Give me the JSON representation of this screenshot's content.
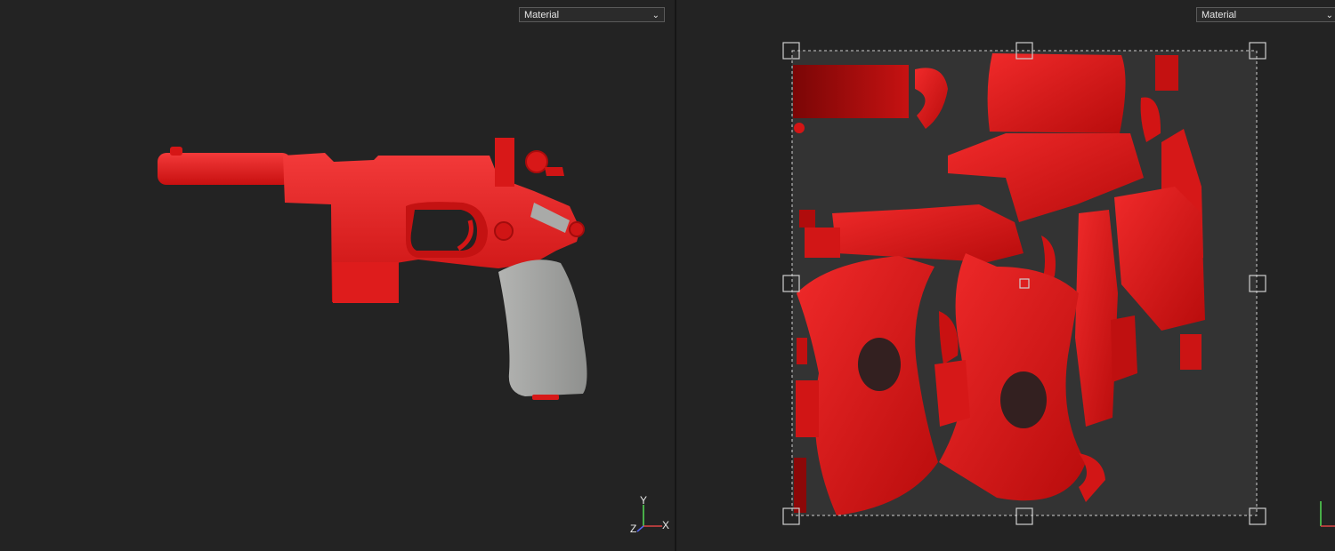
{
  "left_viewport": {
    "shading_mode": "Material",
    "object": "pistol-model",
    "axis_gizmo": {
      "y": "Y",
      "z": "Z",
      "x": "X"
    }
  },
  "right_viewport": {
    "shading_mode": "Material",
    "content": "uv-layout"
  },
  "colors": {
    "background": "#232323",
    "model_red": "#e01a1a",
    "grip_gray": "#9a9b99",
    "uv_frame": "#333333",
    "axis_y": "#55dd55",
    "axis_x": "#dd4444",
    "axis_z": "#5566ee"
  }
}
